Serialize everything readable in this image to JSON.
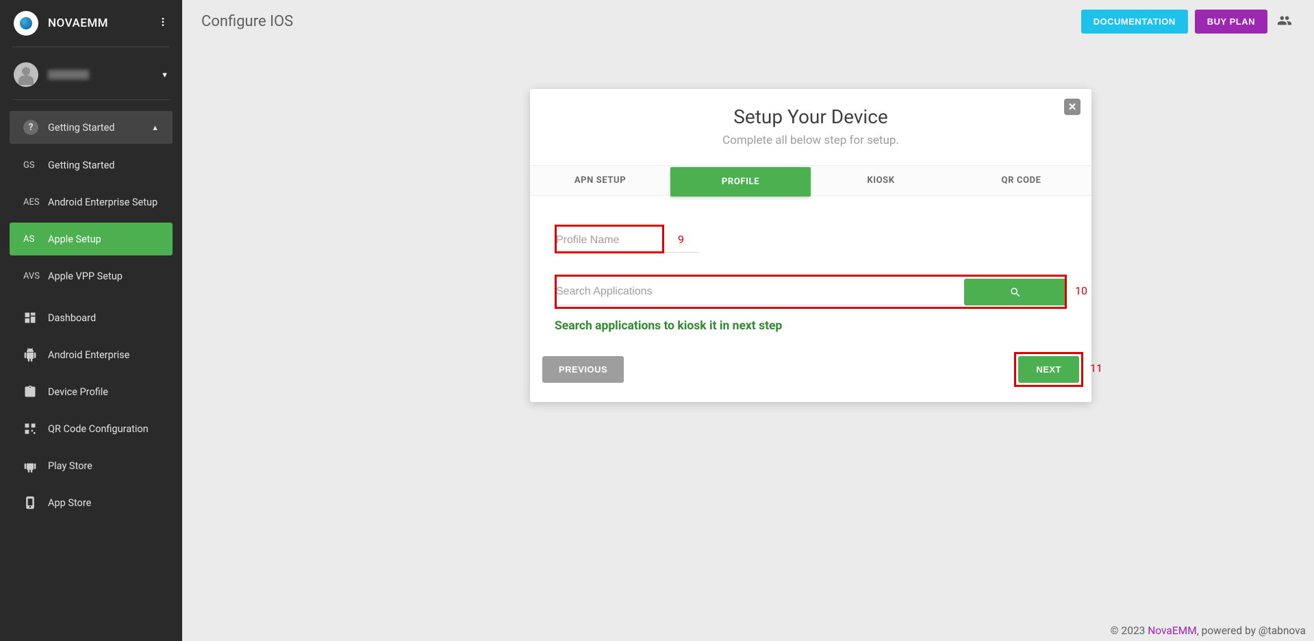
{
  "brand": {
    "name": "NOVAEMM"
  },
  "sidebar": {
    "group": {
      "label": "Getting Started"
    },
    "items": [
      {
        "abbr": "GS",
        "label": "Getting Started"
      },
      {
        "abbr": "AES",
        "label": "Android Enterprise Setup"
      },
      {
        "abbr": "AS",
        "label": "Apple Setup"
      },
      {
        "abbr": "AVS",
        "label": "Apple VPP Setup"
      }
    ],
    "main": [
      {
        "label": "Dashboard"
      },
      {
        "label": "Android Enterprise"
      },
      {
        "label": "Device Profile"
      },
      {
        "label": "QR Code Configuration"
      },
      {
        "label": "Play Store"
      },
      {
        "label": "App Store"
      }
    ]
  },
  "header": {
    "title": "Configure IOS",
    "documentation": "DOCUMENTATION",
    "buy_plan": "BUY PLAN"
  },
  "card": {
    "title": "Setup Your Device",
    "subtitle": "Complete all below step for setup.",
    "tabs": [
      "APN SETUP",
      "PROFILE",
      "KIOSK",
      "QR CODE"
    ],
    "active_tab": 1,
    "profile_placeholder": "Profile Name",
    "search_placeholder": "Search Applications",
    "hint": "Search applications to kiosk it in next step",
    "previous": "PREVIOUS",
    "next": "NEXT"
  },
  "annotations": {
    "profile": "9",
    "search": "10",
    "next": "11"
  },
  "footer": {
    "copyright": "© 2023 ",
    "brand": "NovaEMM",
    "powered": ", powered by @tabnova"
  }
}
